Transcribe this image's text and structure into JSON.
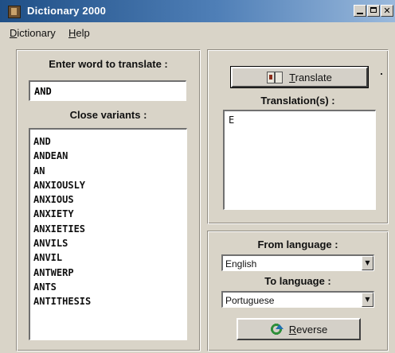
{
  "window": {
    "title": "Dictionary 2000"
  },
  "menu": [
    {
      "label": "Dictionary"
    },
    {
      "label": "Help"
    }
  ],
  "left_panel": {
    "enter_label": "Enter word to translate :",
    "word_value": "AND",
    "variants_label": "Close variants :",
    "variants": [
      "AND",
      "ANDEAN",
      "AN",
      "ANXIOUSLY",
      "ANXIOUS",
      "ANXIETY",
      "ANXIETIES",
      "ANVILS",
      "ANVIL",
      "ANTWERP",
      "ANTS",
      "ANTITHESIS"
    ]
  },
  "right_panel": {
    "translate_button": "Translate",
    "translations_label": "Translation(s) :",
    "translation_value": "E",
    "from_label": "From language :",
    "from_value": "English",
    "to_label": "To language :",
    "to_value": "Portuguese",
    "reverse_button": "Reverse"
  },
  "icons": {
    "app": "dictionary-app-icon",
    "translate": "book-icon",
    "reverse": "reverse-arrows-icon"
  }
}
